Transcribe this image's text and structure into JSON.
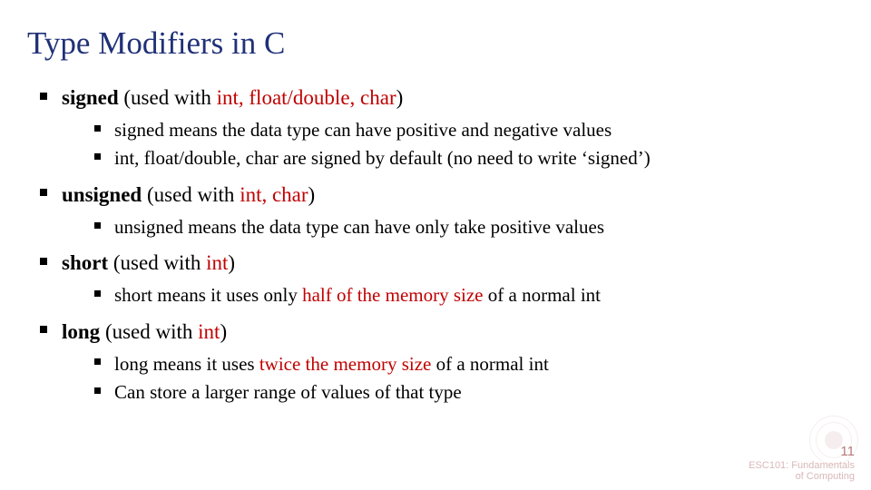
{
  "title": "Type Modifiers in C",
  "items": [
    {
      "head_bold": "signed",
      "head_rest": " (used with ",
      "head_acc": "int, float/double, char",
      "head_close": ")",
      "subs": [
        {
          "t": "signed means the data type can have positive and negative values"
        },
        {
          "t": "int, float/double, char are signed by default (no need to write ‘signed’)"
        }
      ]
    },
    {
      "head_bold": "unsigned",
      "head_rest": " (used with ",
      "head_acc": "int, char",
      "head_close": ")",
      "subs": [
        {
          "t": "unsigned means the data type can have only take positive values"
        }
      ]
    },
    {
      "head_bold": "short",
      "head_rest": " (used with ",
      "head_acc": "int",
      "head_close": ")",
      "subs": [
        {
          "pre": "short means it uses only ",
          "acc": "half of the memory size",
          "post": " of a normal int"
        }
      ]
    },
    {
      "head_bold": "long",
      "head_rest": " (used with ",
      "head_acc": "int",
      "head_close": ")",
      "subs": [
        {
          "pre": "long means it uses ",
          "acc": "twice the memory size",
          "post": " of a normal int"
        },
        {
          "t": "Can store a larger range of values of that type"
        }
      ]
    }
  ],
  "page_number": "11",
  "course_line1": "ESC101: Fundamentals",
  "course_line2": "of Computing"
}
